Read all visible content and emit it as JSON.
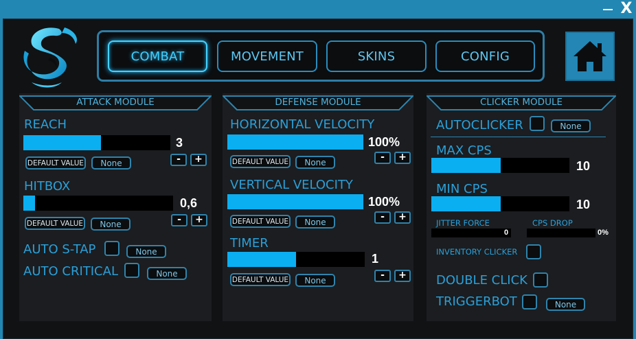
{
  "window": {
    "minimize_icon": "minimize-icon",
    "close_label": "X"
  },
  "colors": {
    "accent": "#0aaff2",
    "border": "#2f84ad",
    "titlebar": "#2287b3",
    "background": "#101214",
    "panel": "#1b1d20"
  },
  "nav": {
    "tabs": [
      {
        "label": "COMBAT",
        "active": true
      },
      {
        "label": "MOVEMENT",
        "active": false
      },
      {
        "label": "SKINS",
        "active": false
      },
      {
        "label": "CONFIG",
        "active": false
      }
    ],
    "home_icon": "home-icon"
  },
  "attack": {
    "title": "ATTACK MODULE",
    "reach": {
      "label": "REACH",
      "value": "3",
      "fill": 0.53,
      "default_label": "DEFAULT VALUE",
      "bind_label": "None"
    },
    "hitbox": {
      "label": "HITBOX",
      "value": "0,6",
      "fill": 0.08,
      "default_label": "DEFAULT VALUE",
      "bind_label": "None"
    },
    "auto_stap": {
      "label": "AUTO S-TAP",
      "bind_label": "None"
    },
    "auto_critical": {
      "label": "AUTO CRITICAL",
      "bind_label": "None"
    },
    "minus": "-",
    "plus": "+"
  },
  "defense": {
    "title": "DEFENSE MODULE",
    "horizontal": {
      "label": "HORIZONTAL VELOCITY",
      "value": "100%",
      "fill": 1.0,
      "default_label": "DEFAULT VALUE",
      "bind_label": "None"
    },
    "vertical": {
      "label": "VERTICAL VELOCITY",
      "value": "100%",
      "fill": 1.0,
      "default_label": "DEFAULT VALUE",
      "bind_label": "None"
    },
    "timer": {
      "label": "TIMER",
      "value": "1",
      "fill": 0.5,
      "default_label": "DEFAULT VALUE",
      "bind_label": "None"
    },
    "minus": "-",
    "plus": "+"
  },
  "clicker": {
    "title": "CLICKER MODULE",
    "autoclicker": {
      "label": "AUTOCLICKER",
      "bind_label": "None"
    },
    "max_cps": {
      "label": "MAX CPS",
      "value": "10",
      "fill": 0.5
    },
    "min_cps": {
      "label": "MIN CPS",
      "value": "10",
      "fill": 0.5
    },
    "jitter": {
      "label": "JITTER FORCE",
      "value": "0",
      "fill": 0
    },
    "cps_drop": {
      "label": "CPS DROP",
      "value": "0%",
      "fill": 0
    },
    "inventory_clicker": {
      "label": "INVENTORY CLICKER"
    },
    "double_click": {
      "label": "DOUBLE CLICK"
    },
    "triggerbot": {
      "label": "TRIGGERBOT",
      "bind_label": "None"
    }
  }
}
